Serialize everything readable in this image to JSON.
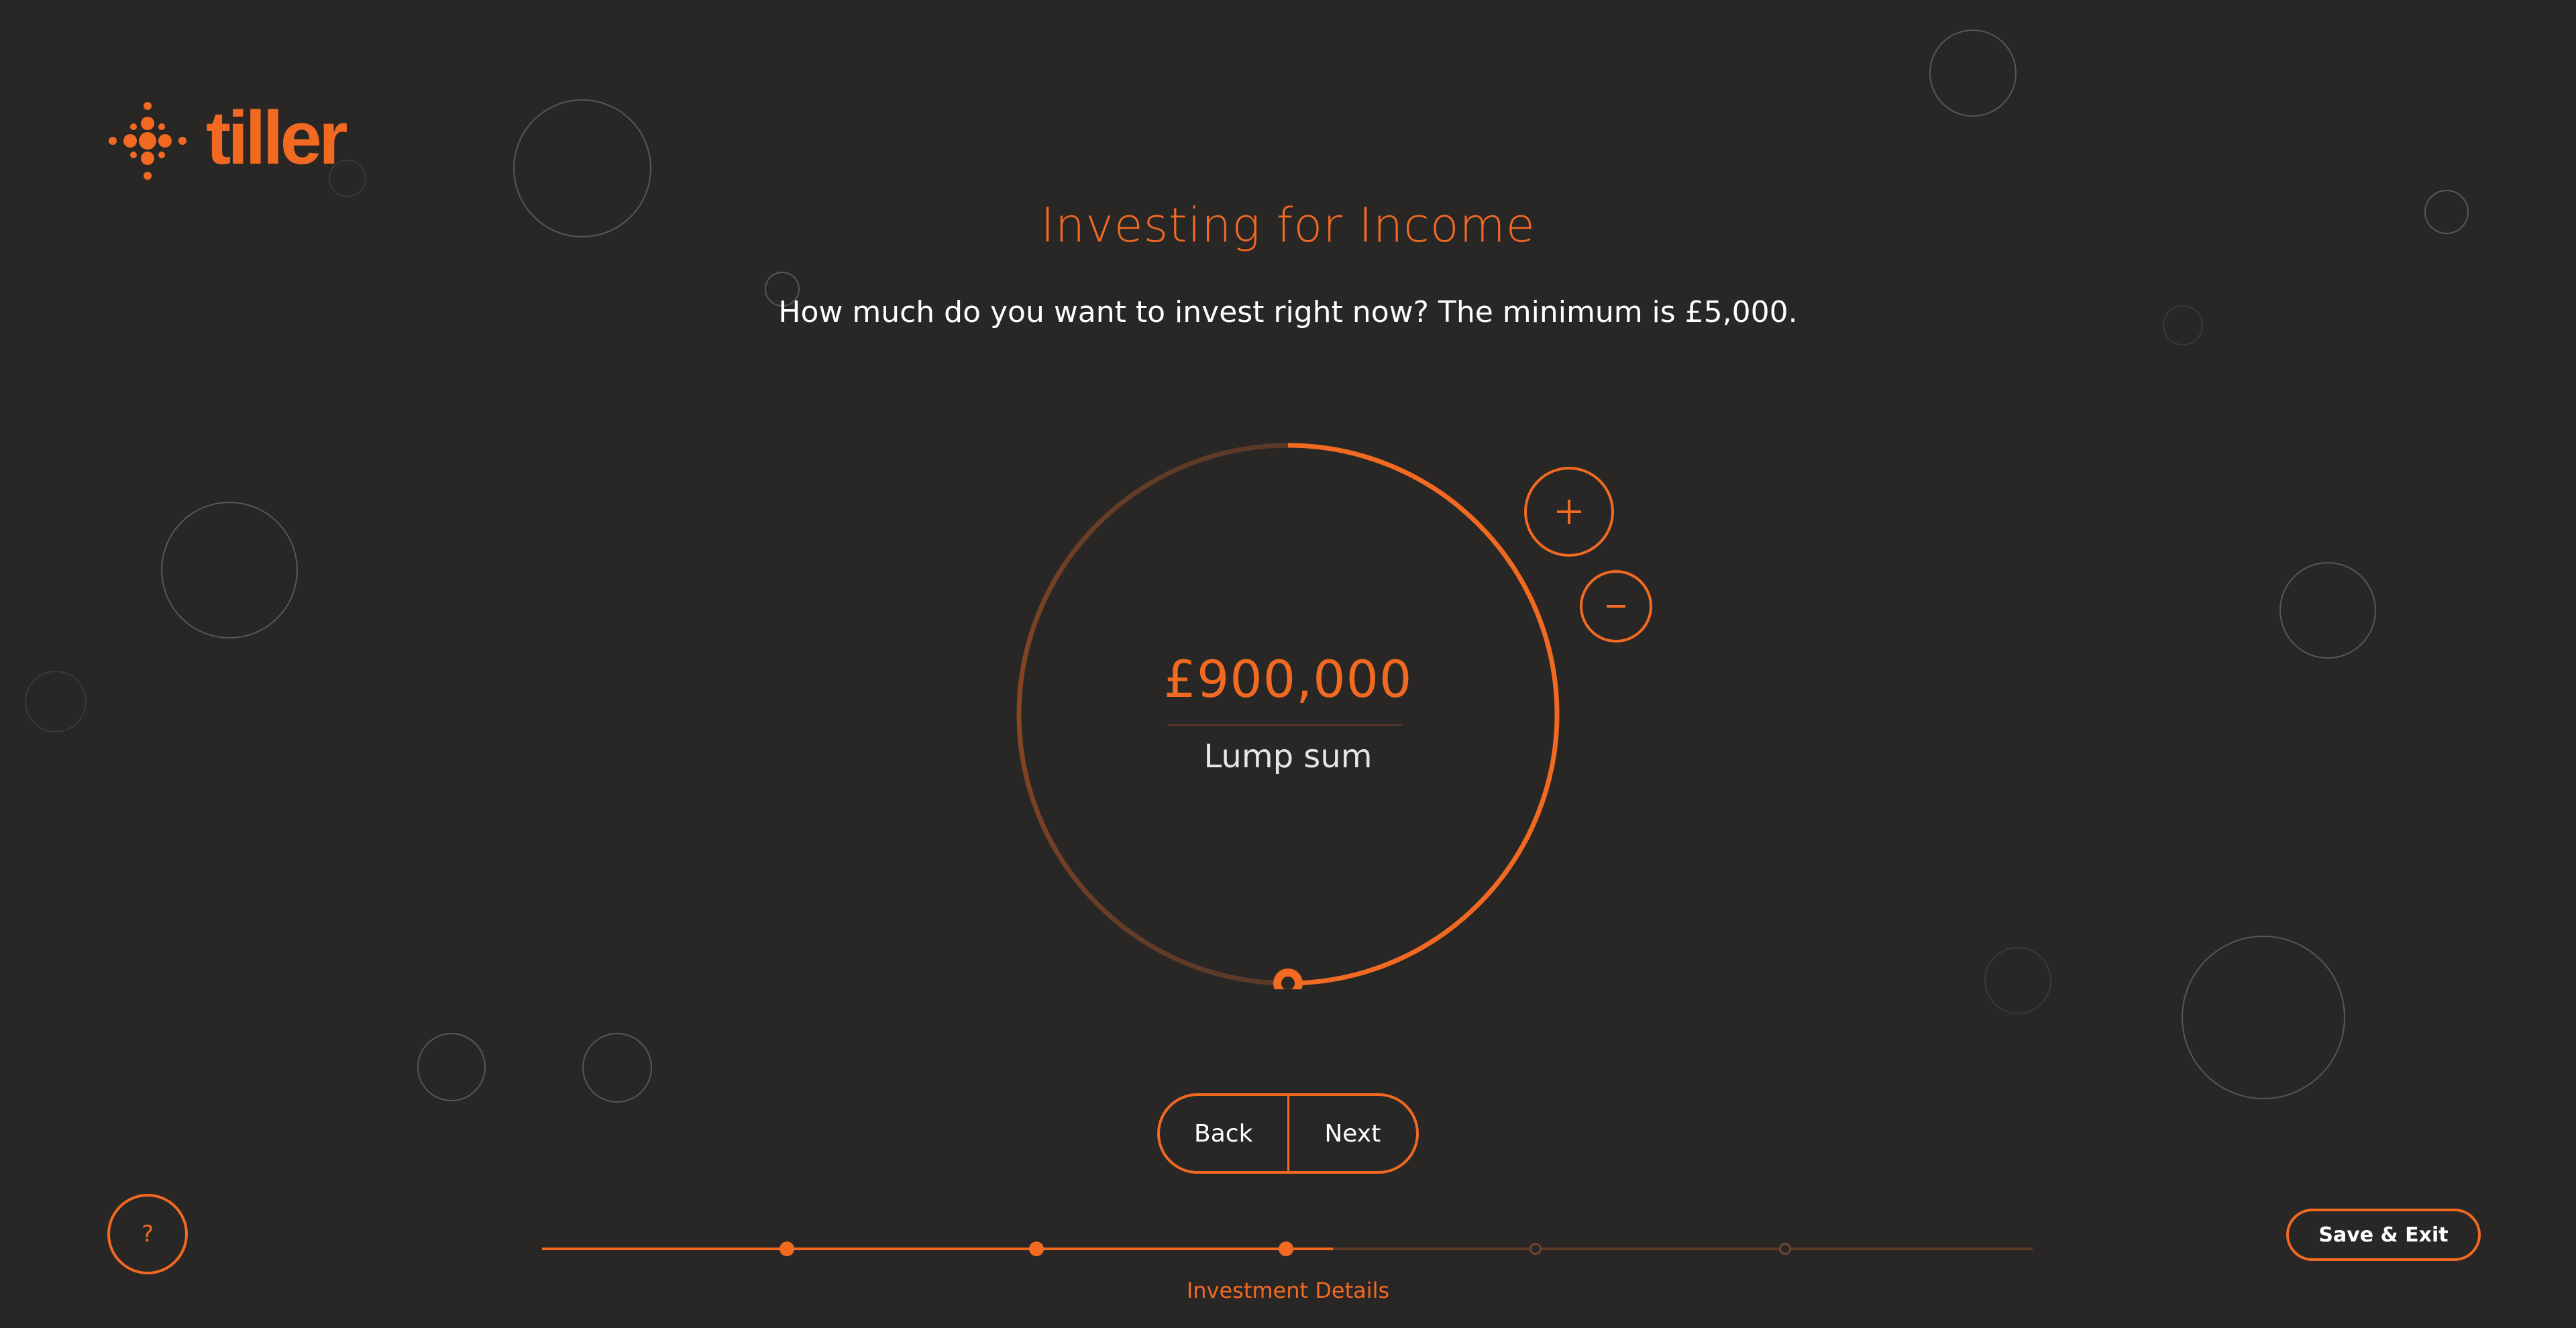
{
  "brand": {
    "name": "tiller",
    "accent_color": "#f26a21",
    "background_color": "#292726"
  },
  "header": {
    "title": "Investing for Income",
    "question": "How much do you want to invest right now? The minimum is £5,000."
  },
  "dial": {
    "amount": "£900,000",
    "label": "Lump sum",
    "fill_fraction": 0.5,
    "increase_icon": "plus-icon",
    "decrease_icon": "minus-icon"
  },
  "navigation": {
    "back_label": "Back",
    "next_label": "Next"
  },
  "progress": {
    "total_steps": 5,
    "completed_steps": 3,
    "current_step_label": "Investment Details"
  },
  "help": {
    "label": "?"
  },
  "save_exit": {
    "label": "Save & Exit"
  }
}
